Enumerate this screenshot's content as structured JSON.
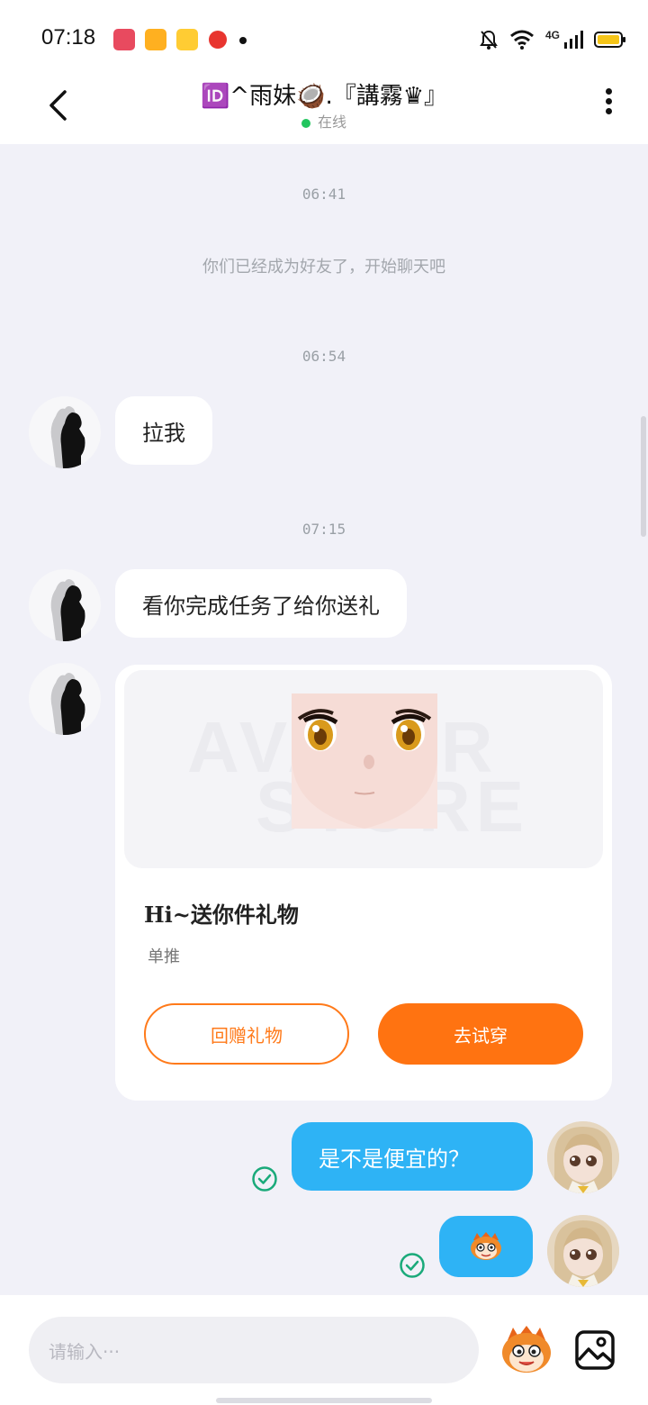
{
  "status_bar": {
    "time": "07:18",
    "network": "4G"
  },
  "header": {
    "title": "🆔^雨妹🥥.『講霧♛』",
    "status": "在线"
  },
  "messages": {
    "ts1": "06:41",
    "system": "你们已经成为好友了，开始聊天吧",
    "ts2": "06:54",
    "msg1": "拉我",
    "ts3": "07:15",
    "msg2": "看你完成任务了给你送礼",
    "gift": {
      "watermark_top": "AVATAR",
      "watermark_bottom": "STORE",
      "title": "Hi~送你件礼物",
      "subtitle": "单推",
      "return_button": "回赠礼物",
      "try_button": "去试穿"
    },
    "msg3": "是不是便宜的？"
  },
  "input": {
    "placeholder": "请输入···"
  },
  "colors": {
    "accent": "#ff7311",
    "bubble_self": "#2eb3f5",
    "online": "#22c55e"
  },
  "icons": [
    "back-arrow-icon",
    "more-vertical-icon",
    "read-check-icon",
    "emoji-icon",
    "image-icon"
  ]
}
